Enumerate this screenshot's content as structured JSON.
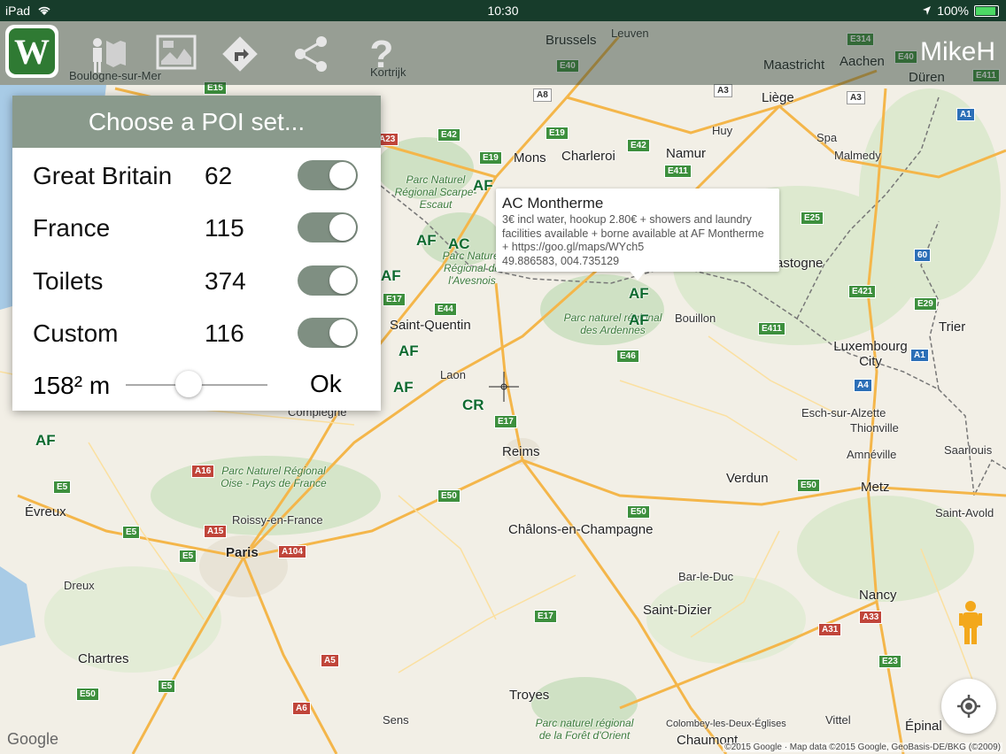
{
  "status_bar": {
    "device": "iPad",
    "time": "10:30",
    "battery": "100%"
  },
  "toolbar": {
    "username": "MikeH",
    "logo_letter": "W"
  },
  "poi_dialog": {
    "title": "Choose a POI set...",
    "rows": [
      {
        "name": "Great Britain",
        "count": "62",
        "enabled": true
      },
      {
        "name": "France",
        "count": "115",
        "enabled": true
      },
      {
        "name": "Toilets",
        "count": "374",
        "enabled": true
      },
      {
        "name": "Custom",
        "count": "116",
        "enabled": true
      }
    ],
    "distance_label": "158² m",
    "ok_label": "Ok"
  },
  "info_window": {
    "title": "AC Montherme",
    "description": "3€ incl water, hookup 2.80€ + showers and laundry facilities available + borne available at AF Montherme + https://goo.gl/maps/WYch5",
    "coords": "49.886583, 004.735129"
  },
  "map": {
    "cities": [
      {
        "name": "Brussels",
        "big": true
      },
      {
        "name": "Leuven"
      },
      {
        "name": "Maastricht"
      },
      {
        "name": "Aachen"
      },
      {
        "name": "Düren"
      },
      {
        "name": "Liège",
        "big": true
      },
      {
        "name": "Huy"
      },
      {
        "name": "Namur",
        "big": true
      },
      {
        "name": "Charleroi",
        "big": true
      },
      {
        "name": "Mons",
        "big": true
      },
      {
        "name": "Spa"
      },
      {
        "name": "Malmedy"
      },
      {
        "name": "Kortrijk"
      },
      {
        "name": "Boulogne-sur-Mer"
      },
      {
        "name": "Bastogne"
      },
      {
        "name": "Bouillon"
      },
      {
        "name": "Trier",
        "big": true
      },
      {
        "name": "Luxembourg City",
        "big": true
      },
      {
        "name": "Saint-Quentin",
        "big": true
      },
      {
        "name": "Laon"
      },
      {
        "name": "Compiègne"
      },
      {
        "name": "Reims",
        "big": true
      },
      {
        "name": "Esch-sur-Alzette"
      },
      {
        "name": "Thionville"
      },
      {
        "name": "Amnéville"
      },
      {
        "name": "Saarlouis"
      },
      {
        "name": "Verdun"
      },
      {
        "name": "Metz",
        "big": true
      },
      {
        "name": "Saint-Avold"
      },
      {
        "name": "Évreux",
        "big": true
      },
      {
        "name": "Roissy-en-France"
      },
      {
        "name": "Paris",
        "big": true
      },
      {
        "name": "Châlons-en-Champagne",
        "big": true
      },
      {
        "name": "Bar-le-Duc"
      },
      {
        "name": "Nancy",
        "big": true
      },
      {
        "name": "Dreux"
      },
      {
        "name": "Saint-Dizier",
        "big": true
      },
      {
        "name": "Chartres",
        "big": true
      },
      {
        "name": "Troyes",
        "big": true
      },
      {
        "name": "Sens"
      },
      {
        "name": "Colombey-les-Deux-Églises"
      },
      {
        "name": "Chaumont",
        "big": true
      },
      {
        "name": "Vittel"
      },
      {
        "name": "Épinal",
        "big": true
      }
    ],
    "parks": [
      "Parc Naturel Régional Scarpe-Escaut",
      "Parc Naturel Régional de l'Avesnois",
      "Parc naturel régional des Ardennes",
      "Parc Naturel Régional Oise - Pays de France",
      "Parc naturel régional de la Forêt d'Orient"
    ],
    "road_shields": [
      "E15",
      "E42",
      "E19",
      "A8",
      "A3",
      "E411",
      "E314",
      "E40",
      "E25",
      "A1",
      "E29",
      "E421",
      "E44",
      "E17",
      "E46",
      "E411",
      "A4",
      "E50",
      "A16",
      "A15",
      "A104",
      "E5",
      "E50",
      "E17",
      "A5",
      "A6",
      "E50",
      "A31",
      "A33",
      "E23",
      "E5",
      "E50",
      "A1",
      "E42",
      "A3",
      "E19",
      "E5",
      "E5",
      "A23",
      "E40",
      "E411",
      "E17",
      "60"
    ],
    "poi_markers": [
      "AF",
      "AF",
      "AC",
      "AF",
      "AF",
      "AF",
      "AF",
      "AF",
      "CR",
      "AF"
    ],
    "copyright": "©2015 Google · Map data ©2015 Google, GeoBasis-DE/BKG (©2009)",
    "google_logo": "Google"
  },
  "colors": {
    "status_bar": "#173c2b",
    "toolbar_overlay": "rgba(40,60,48,0.45)",
    "dialog_header": "#8a9a8c",
    "toggle_on": "#7f8f82",
    "poi_marker": "#0e6a2f"
  }
}
